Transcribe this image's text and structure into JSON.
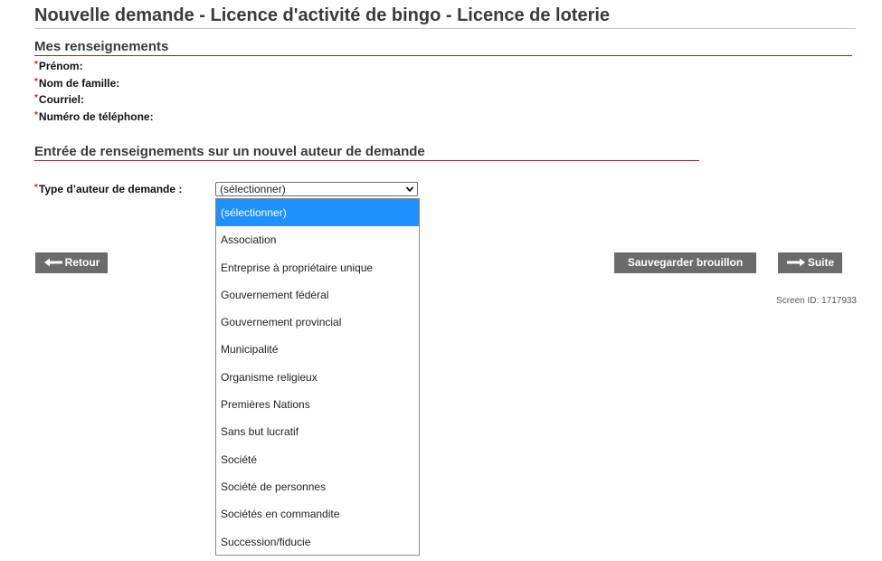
{
  "page": {
    "title": "Nouvelle demande - Licence d'activité de bingo - Licence de loterie"
  },
  "mes_renseignements": {
    "heading": "Mes renseignements",
    "required_marker": "*",
    "fields": [
      {
        "label": "Prénom:"
      },
      {
        "label": "Nom de famille:"
      },
      {
        "label": "Courriel:"
      },
      {
        "label": "Numéro de téléphone:"
      }
    ]
  },
  "nouvel_auteur": {
    "heading": "Entrée de renseignements sur un nouvel auteur de demande",
    "type_label": "Type d’auteur de demande :",
    "selected_value": "(sélectionner)",
    "options": [
      "(sélectionner)",
      "Association",
      "Entreprise à propriétaire unique",
      "Gouvernement fédéral",
      "Gouvernement provincial",
      "Municipalité",
      "Organisme religieux",
      "Premières Nations",
      "Sans but lucratif",
      "Société",
      "Société de personnes",
      "Sociétés en commandite",
      "Succession/fiducie"
    ]
  },
  "buttons": {
    "back": "Retour",
    "save_draft": "Sauvegarder brouillon",
    "next": "Suite"
  },
  "footer": {
    "screen_id": "Screen ID: 1717933"
  },
  "colors": {
    "accent_rule": "#a0251e",
    "required": "#c0271d",
    "button_bg": "#6b6b6b",
    "selected_option": "#1e90ff"
  }
}
